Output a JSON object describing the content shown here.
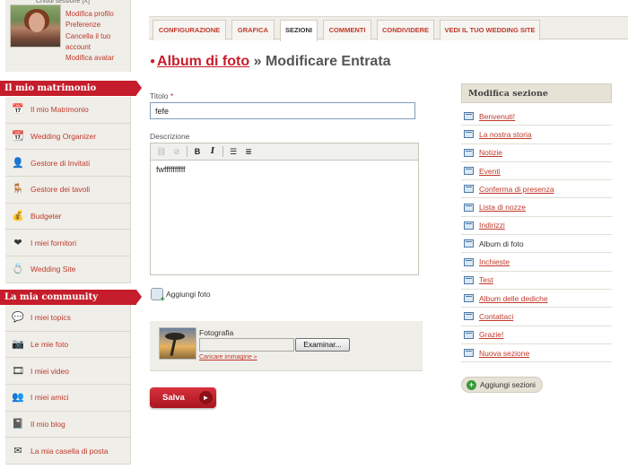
{
  "profile": {
    "top_text": "Chiudi sessione [X]",
    "links": [
      "Modifica profilo",
      "Preferenze",
      "Cancella il tuo account",
      "Modifica avatar"
    ]
  },
  "sections": {
    "wedding": {
      "title": "Il mio matrimonio",
      "items": [
        {
          "label": "Il mio Matrimonio",
          "icon": "calendar-clock-icon",
          "glyph": "📅"
        },
        {
          "label": "Wedding Organizer",
          "icon": "planner-icon",
          "glyph": "📆"
        },
        {
          "label": "Gestore di Invitati",
          "icon": "guests-icon",
          "glyph": "👤"
        },
        {
          "label": "Gestore dei tavoli",
          "icon": "tables-icon",
          "glyph": "🪑"
        },
        {
          "label": "Budgeter",
          "icon": "budget-icon",
          "glyph": "💰"
        },
        {
          "label": "I miei fornitori",
          "icon": "heart-folder-icon",
          "glyph": "❤"
        },
        {
          "label": "Wedding Site",
          "icon": "rings-icon",
          "glyph": "💍"
        }
      ]
    },
    "community": {
      "title": "La mia community",
      "items": [
        {
          "label": "I miei topics",
          "icon": "chat-bubbles-icon",
          "glyph": "💬"
        },
        {
          "label": "Le mie foto",
          "icon": "photo-icon",
          "glyph": "📷"
        },
        {
          "label": "I miei video",
          "icon": "film-icon",
          "glyph": "🎞"
        },
        {
          "label": "I miei amici",
          "icon": "friends-icon",
          "glyph": "👥"
        },
        {
          "label": "Il mio blog",
          "icon": "blog-icon",
          "glyph": "📓"
        },
        {
          "label": "La mia casella di posta",
          "icon": "mailbox-icon",
          "glyph": "✉"
        }
      ]
    }
  },
  "tabs": [
    {
      "label": "CONFIGURAZIONE",
      "active": false
    },
    {
      "label": "GRAFICA",
      "active": false
    },
    {
      "label": "SEZIONI",
      "active": true
    },
    {
      "label": "COMMENTI",
      "active": false
    },
    {
      "label": "CONDIVIDERE",
      "active": false
    },
    {
      "label": "VEDI IL TUO WEDDING SITE",
      "active": false
    }
  ],
  "page": {
    "crumb": "Album di foto",
    "separator": "»",
    "title": "Modificare Entrata"
  },
  "form": {
    "title_label": "Titolo",
    "required_mark": "*",
    "title_value": "fefe",
    "description_label": "Descrizione",
    "description_value": "fwffffffffff",
    "add_photo_label": "Aggiungi foto",
    "photo_label": "Fotografia",
    "browse_label": "Examinar...",
    "upload_link": "Caricare immagine »",
    "save_label": "Salva"
  },
  "editor_toolbar": {
    "bold": "B",
    "italic": "I"
  },
  "side_panel": {
    "title": "Modifica sezione",
    "items": [
      {
        "label": "Benvenuti!",
        "current": false
      },
      {
        "label": "La nostra storia",
        "current": false
      },
      {
        "label": "Notizie",
        "current": false
      },
      {
        "label": "Eventi",
        "current": false
      },
      {
        "label": "Conferma di presenza",
        "current": false
      },
      {
        "label": "Lista di nozze",
        "current": false
      },
      {
        "label": "Indirizzi",
        "current": false
      },
      {
        "label": "Album di foto",
        "current": true
      },
      {
        "label": "Inchieste",
        "current": false
      },
      {
        "label": "Test",
        "current": false
      },
      {
        "label": "Album delle dediche",
        "current": false
      },
      {
        "label": "Contattaci",
        "current": false
      },
      {
        "label": "Grazie!",
        "current": false
      },
      {
        "label": "Nuova sezione",
        "current": false
      }
    ],
    "add_label": "Aggiungi sezioni"
  },
  "colors": {
    "brand_red": "#c51d2b",
    "link_red": "#c0392b",
    "panel_beige": "#efeee9"
  }
}
